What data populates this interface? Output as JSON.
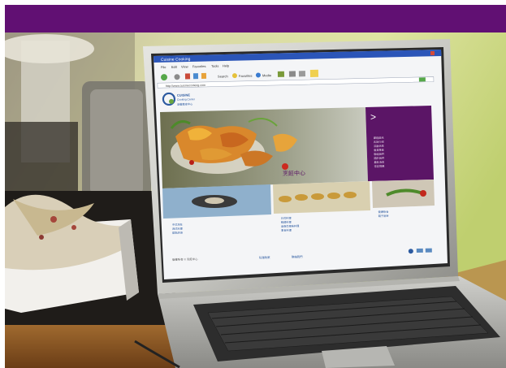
{
  "banner": {
    "color": "#611073"
  },
  "browser": {
    "window_title": "Cuisine Cooking",
    "menu": [
      "File",
      "Edit",
      "View",
      "Favorites",
      "Tools",
      "Help"
    ],
    "toolbar_buttons": [
      "Back",
      "Search",
      "Favorites",
      "Media"
    ],
    "address": "http://www.cuisinecooking.com"
  },
  "website": {
    "logo_line1": "CUISINE",
    "logo_line2": "Cooking Center",
    "logo_cn": "廚藝教室中心",
    "hero_caption": "烹飪中心",
    "side_arrow": ">",
    "side_links": [
      "課程資訊",
      "名師介紹",
      "活動消息",
      "會員專區",
      "聯絡我們",
      "關於我們",
      "最新消息",
      "常見問題"
    ],
    "col1_links": [
      "中式烹飪",
      "西式料理",
      "甜點烘焙"
    ],
    "col2_links": [
      "日式料理",
      "韓國料理",
      "東南亞風味料理",
      "素食料理"
    ],
    "col3_links": [
      "健康飲食",
      "親子廚房"
    ],
    "footer_text": "版權所有 © 烹飪中心",
    "footer_link1": "私隱政策",
    "footer_link2": "聯絡我們",
    "accent_purple": "#5b1566"
  }
}
